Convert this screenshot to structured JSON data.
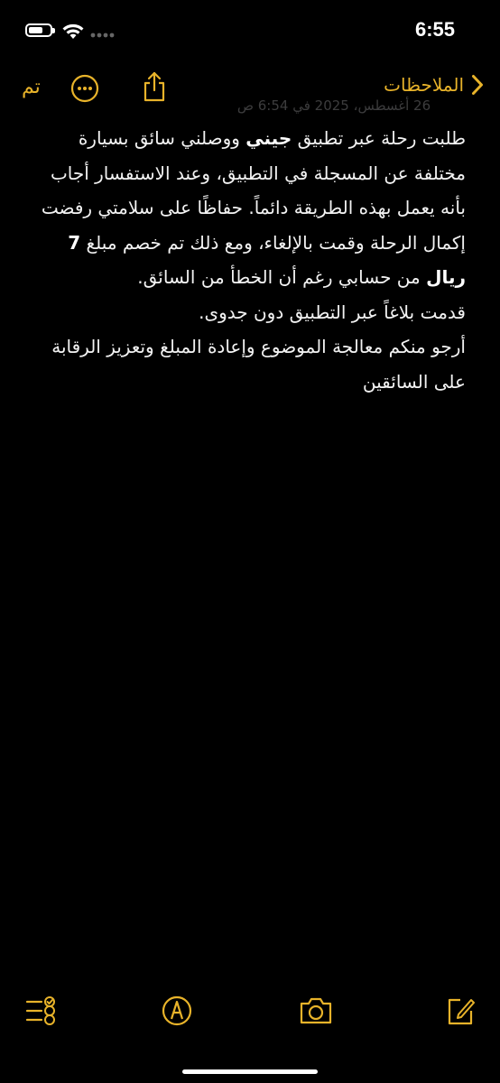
{
  "status_bar": {
    "time": "6:55",
    "battery_level": 0.7
  },
  "nav": {
    "back_label": "الملاحظات",
    "done_label": "تم"
  },
  "note": {
    "date": "26 أغسطس، 2025 في 6:54 ص",
    "line1_before": "طلبت رحلة عبر تطبيق ",
    "line1_bold": "جيني",
    "line1_after": " ووصلني سائق بسيارة مختلفة عن المسجلة في التطبيق، وعند الاستفسار أجاب بأنه يعمل بهذه الطريقة دائماً. حفاظًا على سلامتي رفضت إكمال الرحلة وقمت بالإلغاء، ومع ذلك تم خصم مبلغ ",
    "line1_bold2": "7 ريال",
    "line1_end": " من حسابي رغم أن الخطأ من السائق.",
    "line2": "قدمت بلاغاً عبر التطبيق دون جدوى.",
    "line3": "أرجو منكم معالجة الموضوع وإعادة المبلغ وتعزيز الرقابة على السائقين"
  },
  "colors": {
    "accent": "#e8b32a",
    "background": "#000000",
    "text": "#f2f2f2"
  },
  "icons": {
    "more": "ellipsis-circle-icon",
    "share": "share-icon",
    "back": "chevron-right-icon",
    "compose": "compose-icon",
    "markup": "markup-pen-icon",
    "camera": "camera-icon",
    "checklist": "checklist-icon"
  }
}
